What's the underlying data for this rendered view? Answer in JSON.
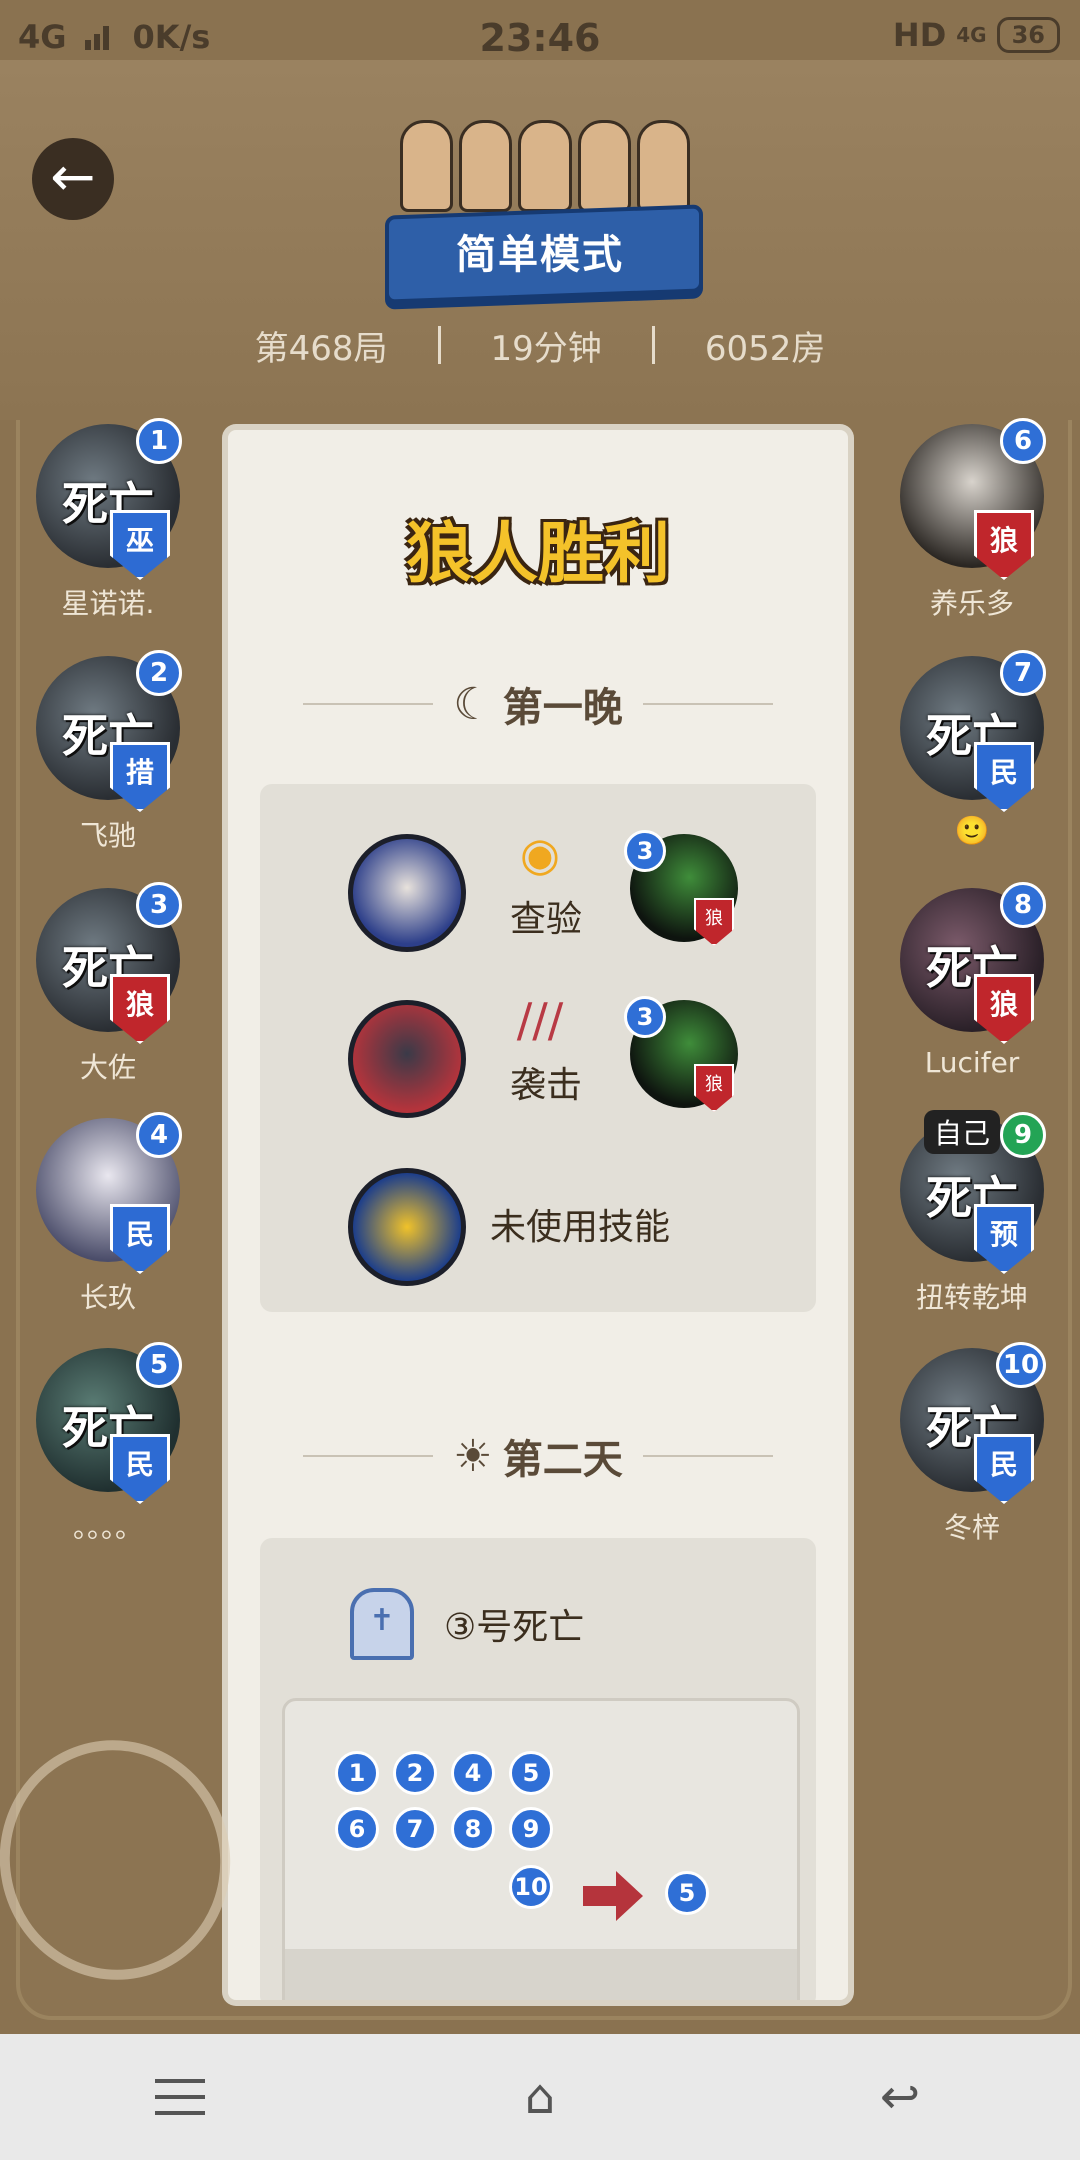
{
  "status_bar": {
    "network": "4G",
    "speed": "0K/s",
    "time": "23:46",
    "hd": "HD",
    "network_right": "4G",
    "battery": "36"
  },
  "header": {
    "mode": "简单模式",
    "round": "第468局",
    "duration": "19分钟",
    "room": "6052房"
  },
  "players_left": [
    {
      "number": "1",
      "name": "星诺诺.",
      "role": "巫",
      "status": "死亡",
      "role_type": "good"
    },
    {
      "number": "2",
      "name": "飞驰",
      "role": "措",
      "status": "死亡",
      "role_type": "good"
    },
    {
      "number": "3",
      "name": "大佐",
      "role": "狼",
      "status": "死亡",
      "role_type": "wolf"
    },
    {
      "number": "4",
      "name": "长玖",
      "role": "民",
      "status": "",
      "role_type": "good"
    },
    {
      "number": "5",
      "name": "。。。。",
      "role": "民",
      "status": "死亡",
      "role_type": "good"
    }
  ],
  "players_right": [
    {
      "number": "6",
      "name": "养乐多",
      "role": "狼",
      "status": "",
      "role_type": "wolf"
    },
    {
      "number": "7",
      "name": "🙂",
      "role": "民",
      "status": "死亡",
      "role_type": "good"
    },
    {
      "number": "8",
      "name": "Lucifer",
      "role": "狼",
      "status": "死亡",
      "role_type": "wolf"
    },
    {
      "number": "9",
      "name": "扭转乾坤",
      "role": "预",
      "status": "死亡",
      "role_type": "good",
      "self_tag": "自己"
    },
    {
      "number": "10",
      "name": "冬梓",
      "role": "民",
      "status": "死亡",
      "role_type": "good"
    }
  ],
  "result": {
    "title": "狼人胜利"
  },
  "night1": {
    "heading": "第一晚",
    "actions": [
      {
        "label": "查验",
        "target_number": "3",
        "target_role": "狼"
      },
      {
        "label": "袭击",
        "target_number": "3",
        "target_role": "狼"
      }
    ],
    "unused_label": "未使用技能"
  },
  "day2": {
    "heading": "第二天",
    "death_text": "③号死亡",
    "voters": [
      "1",
      "2",
      "4",
      "5",
      "6",
      "7",
      "8",
      "9",
      "10"
    ],
    "vote_target": "5"
  },
  "colors": {
    "accent_blue": "#2f6fd6",
    "wolf_red": "#c0262c",
    "panel": "#f1eee7",
    "background": "#8a7250"
  },
  "icons": {
    "back": "back-arrow-icon",
    "menu": "menu-icon",
    "home": "home-icon",
    "return": "return-icon"
  }
}
